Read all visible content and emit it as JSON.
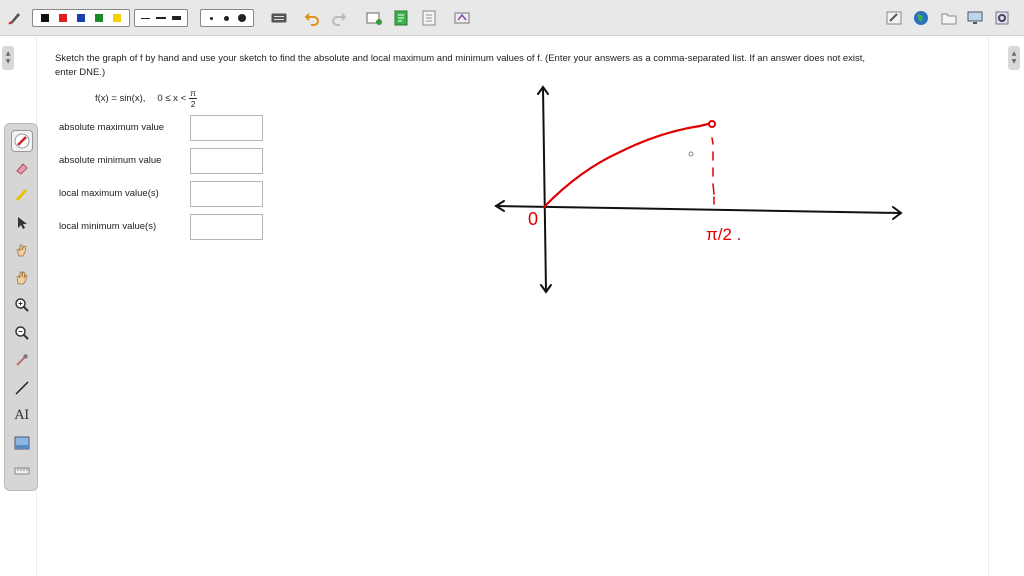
{
  "toolbar": {
    "colors": [
      "#111111",
      "#e02020",
      "#1a3fb0",
      "#1a8a2a",
      "#f2d200"
    ],
    "line_weights": [
      "thin",
      "medium",
      "thick"
    ],
    "dot_sizes": [
      "small",
      "medium",
      "large"
    ],
    "icons_left": [
      "keyboard-icon",
      "undo-icon",
      "redo-icon",
      "add-page-icon",
      "green-page-icon",
      "document-icon",
      "clear-icon"
    ],
    "icons_right": [
      "edit-icon",
      "globe-icon",
      "folder-icon",
      "monitor-icon",
      "settings-icon"
    ]
  },
  "palette": {
    "tools": [
      "pen-tool",
      "eraser-tool",
      "highlighter-tool",
      "pointer-tool",
      "hand-select-tool",
      "pan-tool",
      "zoom-in-tool",
      "zoom-out-tool",
      "eyedropper-tool",
      "line-tool",
      "text-tool",
      "image-tool",
      "ruler-tool"
    ],
    "text_tool_label": "AI"
  },
  "question": {
    "text": "Sketch the graph of f by hand and use your sketch to find the absolute and local maximum and minimum values of f. (Enter your answers as a comma-separated list. If an answer does not exist, enter DNE.)",
    "formula_left": "f(x) = sin(x),",
    "formula_domain": "0 ≤ x <",
    "frac_num": "π",
    "frac_den": "2"
  },
  "answers": [
    {
      "label": "absolute maximum value",
      "value": ""
    },
    {
      "label": "absolute minimum value",
      "value": ""
    },
    {
      "label": "local maximum value(s)",
      "value": ""
    },
    {
      "label": "local minimum value(s)",
      "value": ""
    }
  ],
  "sketch": {
    "origin_label": "0",
    "end_label": "π/2 .",
    "ink_color": "#e00000",
    "axis_color": "#111111"
  }
}
